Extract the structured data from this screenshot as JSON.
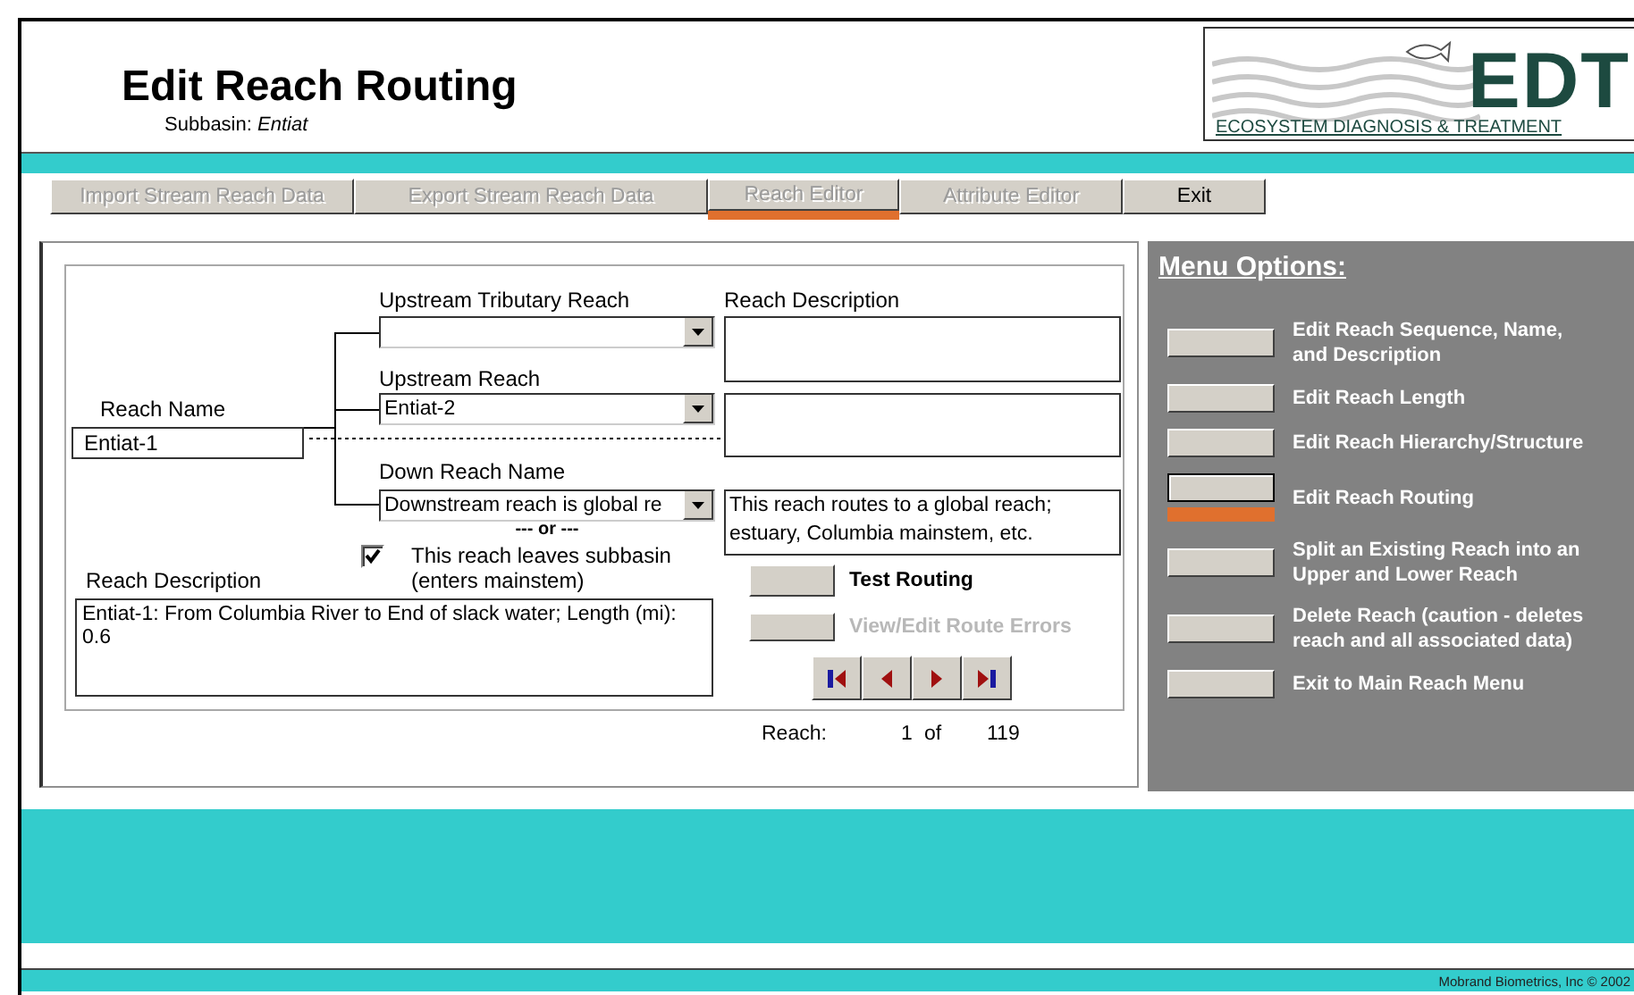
{
  "header": {
    "title": "Edit Reach Routing",
    "subbasin_label": "Subbasin:",
    "subbasin": "Entiat"
  },
  "logo": {
    "mark": "EDT",
    "tagline": "ECOSYSTEM DIAGNOSIS & TREATMENT"
  },
  "tabs": [
    {
      "label": "Import Stream Reach Data",
      "selected": false,
      "disabled": true
    },
    {
      "label": "Export Stream Reach Data",
      "selected": false,
      "disabled": true
    },
    {
      "label": "Reach Editor",
      "selected": true,
      "disabled": true
    },
    {
      "label": "Attribute Editor",
      "selected": false,
      "disabled": true
    },
    {
      "label": "Exit",
      "selected": false,
      "disabled": false
    }
  ],
  "form": {
    "reach_name": {
      "label": "Reach Name",
      "value": "Entiat-1"
    },
    "description_heading": "Reach Description",
    "dropdowns": [
      {
        "label": "Upstream Tributary Reach"
      },
      {
        "label": "Upstream Reach",
        "value": "Entiat-2"
      },
      {
        "label": "Down Reach Name",
        "value": "Downstream reach is global re",
        "description": "This reach routes to a global reach; estuary, Columbia mainstem, etc."
      }
    ],
    "or_text": "--- or ---",
    "leaves_subbasin": {
      "label": "This reach leaves subbasin",
      "note": "(enters mainstem)",
      "checked": true
    },
    "reach_description": {
      "label": "Reach Description",
      "value": "Entiat-1: From Columbia River to End of slack water; Length (mi): 0.6"
    },
    "actions": [
      {
        "label": "Test Routing",
        "disabled": false
      },
      {
        "label": "View/Edit Route Errors",
        "disabled": true
      }
    ],
    "navigation": [
      {
        "kind": "first"
      },
      {
        "kind": "previous"
      },
      {
        "kind": "next"
      },
      {
        "kind": "last"
      }
    ]
  },
  "record": {
    "label": "Reach:",
    "current": "1",
    "of": "of",
    "total": "119"
  },
  "menu": {
    "title": "Menu Options:",
    "items": [
      {
        "label": "Edit Reach Sequence, Name, and Description",
        "selected": false
      },
      {
        "label": "Edit Reach Length",
        "selected": false
      },
      {
        "label": "Edit Reach Hierarchy/Structure",
        "selected": false
      },
      {
        "label": "Edit Reach Routing",
        "selected": true
      },
      {
        "label": "Split an Existing Reach into an Upper and Lower Reach",
        "selected": false
      },
      {
        "label": "Delete Reach (caution - deletes reach and all associated data)",
        "selected": false
      },
      {
        "label": "Exit to Main Reach Menu",
        "selected": false
      }
    ]
  },
  "footer": {
    "credit": "Mobrand Biometrics, Inc © 2002"
  }
}
